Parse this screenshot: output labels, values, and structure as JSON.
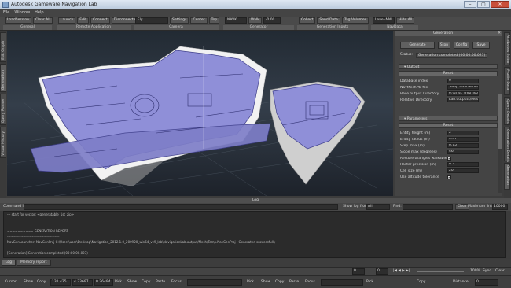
{
  "window": {
    "title": "Autodesk Gameware Navigation Lab"
  },
  "menu": [
    "File",
    "Window",
    "Help"
  ],
  "toolbar": {
    "groups": [
      {
        "caption": "General",
        "buttons": [
          "LoadSession",
          "Clear All"
        ]
      },
      {
        "caption": "Remote Application",
        "buttons": [
          "Launch",
          "Edit",
          "Connect",
          "Disconnected"
        ]
      },
      {
        "caption": "Camera",
        "select": "Fly",
        "buttons": [
          "Settings",
          "Center",
          "Top"
        ]
      },
      {
        "caption": "Generator",
        "select": "NAVK",
        "buttons": [
          "Walk",
          "-0.00"
        ]
      },
      {
        "caption": "Generation Inputs",
        "buttons": [
          "Collect",
          "Send Data",
          "Tag Volumes"
        ]
      },
      {
        "caption": "NavData",
        "select": "Level-NM",
        "buttons": [
          "Hide All"
        ]
      }
    ]
  },
  "left_tabs": [
    "Edit Graph",
    "Generation",
    "Query Runner",
    "Visual History"
  ],
  "right_tabs": [
    "Attributes Editor",
    "Profile Data",
    "Query Details",
    "Generation Details",
    "Generation"
  ],
  "panel": {
    "title": "Generation",
    "buttons": {
      "generate": "Generate",
      "stop": "Stop",
      "config": "Config",
      "save": "Save"
    },
    "status_label": "Status:",
    "status_value": "Generation completed (00.00.00.027)",
    "output": {
      "header": "Output",
      "reset": "Reset",
      "props": [
        {
          "label": "Database index",
          "value": "0"
        },
        {
          "label": "NavMeshPtr file",
          "value": "Temp.NavGenVer"
        },
        {
          "label": "Base output Directory",
          "value": "e:\\ui_sc_tmp_iso_d_bb"
        },
        {
          "label": "Relative Directory",
          "value": "Lab.outputs/Mesh"
        }
      ]
    },
    "parameters": {
      "header": "Parameters",
      "reset": "Reset",
      "props": [
        {
          "label": "Entity height (m)",
          "value": "2"
        },
        {
          "label": "Entity radius (m)",
          "value": "0.47"
        },
        {
          "label": "Step max (m)",
          "value": "0.75"
        },
        {
          "label": "Slope max (degrees)",
          "value": "46"
        },
        {
          "label": "Restore triangles walkable",
          "value": "✔",
          "type": "check"
        },
        {
          "label": "Raster precision (m)",
          "value": "0.2"
        },
        {
          "label": "Cell size (m)",
          "value": "20"
        },
        {
          "label": "Use altitude tolerance",
          "value": "✔",
          "type": "check"
        }
      ]
    }
  },
  "log": {
    "title": "Log",
    "command_label": "Command line:",
    "show_log_from_label": "Show log from:",
    "show_log_from_value": "All",
    "find_label": "Find:",
    "clear_label": "Clear",
    "max_lines_label": "Maximum lines:",
    "max_lines_value": "10000",
    "lines": [
      "--- start for vector: <generatable_1st_zip>",
      "----------------------------------------------",
      "",
      "========== GENERATION REPORT",
      "----------------------------------------------",
      "NavGenLauncher: NavGenProj C:\\Users\\user\\Desktop\\Navigation_2012.1.0_200920_win64_vc9_lab\\NavigationLab.output/Mesh/Temp.NavGenProj : Generated successfully",
      "",
      "[Generation] Generation completed (00:00:00.027)"
    ],
    "tabs": [
      "Log",
      "Memory report"
    ]
  },
  "timeline": {
    "start": "0",
    "end": "0",
    "zoom": "100%",
    "sync_label": "Sync",
    "clear_label": "Clear"
  },
  "bottombar": {
    "items": [
      "Cursor:",
      "Show",
      "Copy",
      "131.425",
      "4.33697",
      "0.26494",
      "Pick",
      "Show",
      "Copy",
      "Paste",
      "Focus",
      "Pick",
      "Show",
      "Copy",
      "Paste",
      "Focus",
      "Pick",
      "Copy",
      "Distance:",
      "0"
    ]
  }
}
